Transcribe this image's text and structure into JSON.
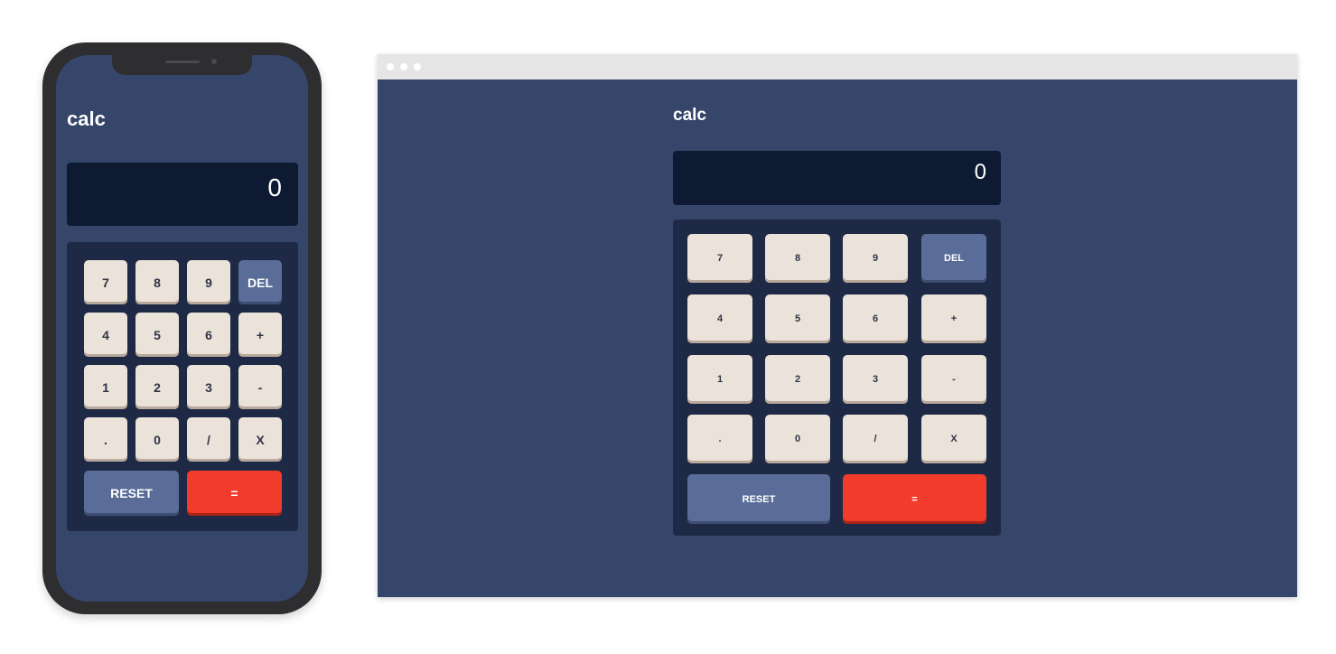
{
  "app": {
    "title": "calc",
    "display_value": "0"
  },
  "keypad": {
    "rows": [
      [
        "7",
        "8",
        "9",
        "DEL"
      ],
      [
        "4",
        "5",
        "6",
        "+"
      ],
      [
        "1",
        "2",
        "3",
        "-"
      ],
      [
        ".",
        "0",
        "/",
        "X"
      ]
    ],
    "reset_label": "RESET",
    "equals_label": "="
  },
  "icons": {
    "browser_window_controls": [
      "window-dot-icon",
      "window-dot-icon",
      "window-dot-icon"
    ]
  },
  "colors": {
    "background": "#35466a",
    "display": "#0d1a31",
    "keypad": "#1e2a45",
    "key": "#ebe2da",
    "key_text": "#2f3444",
    "accent_blue": "#5a6d99",
    "accent_red": "#f13b2b"
  }
}
